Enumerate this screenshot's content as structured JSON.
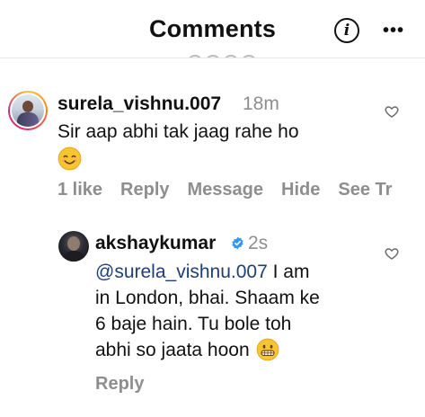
{
  "header": {
    "title": "Comments",
    "info_icon": "info-icon",
    "more_icon": "more-horizontal-icon"
  },
  "comments": [
    {
      "username": "surela_vishnu.007",
      "time": "18m",
      "text": "Sir aap abhi tak jaag rahe ho",
      "emoji": "😊",
      "actions": {
        "likes": "1 like",
        "reply": "Reply",
        "message": "Message",
        "hide": "Hide",
        "see_translation": "See Tr"
      }
    }
  ],
  "reply": {
    "username": "akshaykumar",
    "verified": true,
    "time": "2s",
    "mention": "@surela_vishnu.007",
    "text_line1": " I am",
    "text_line2": "in London, bhai. Shaam ke",
    "text_line3": "6 baje hain. Tu bole toh",
    "text_line4": "abhi so jaata hoon",
    "emoji": "😬",
    "action_reply": "Reply"
  },
  "colors": {
    "text": "#111111",
    "muted": "#8e8e8e",
    "mention": "#1d3f73",
    "verified": "#3897f0"
  }
}
